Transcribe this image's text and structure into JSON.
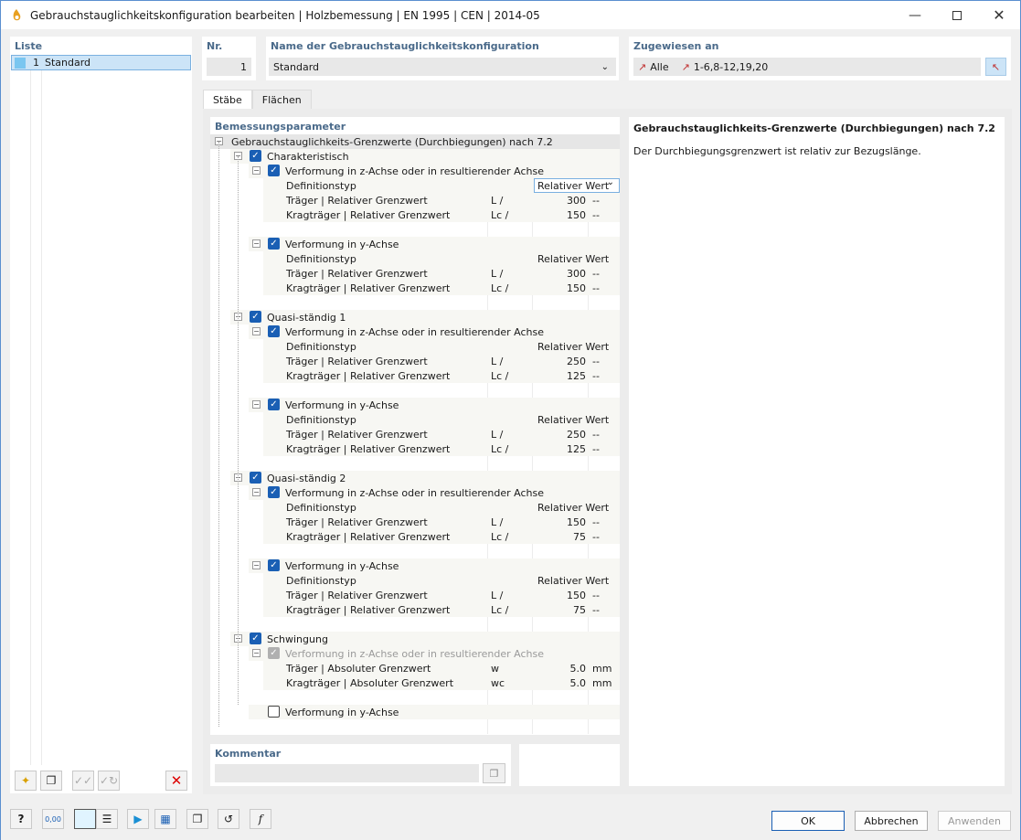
{
  "window": {
    "title": "Gebrauchstauglichkeitskonfiguration bearbeiten | Holzbemessung | EN 1995 | CEN | 2014-05"
  },
  "liste": {
    "title": "Liste",
    "items": [
      {
        "num": "1",
        "label": "Standard"
      }
    ]
  },
  "nr": {
    "title": "Nr.",
    "value": "1"
  },
  "name": {
    "title": "Name der Gebrauchstauglichkeitskonfiguration",
    "value": "Standard"
  },
  "zugewiesen": {
    "title": "Zugewiesen an",
    "alle": "Alle",
    "members": "1-6,8-12,19,20"
  },
  "tabs": [
    "Stäbe",
    "Flächen"
  ],
  "params": {
    "title": "Bemessungsparameter"
  },
  "tree": [
    {
      "lvl": 0,
      "tog": "-",
      "text": "Gebrauchstauglichkeits-Grenzwerte (Durchbiegungen) nach 7.2",
      "hl": true
    },
    {
      "lvl": 1,
      "tog": "-",
      "cb": "on",
      "text": "Charakteristisch"
    },
    {
      "lvl": 2,
      "tog": "-",
      "cb": "on",
      "text": "Verformung in z-Achse oder in resultierender Achse"
    },
    {
      "lvl": 3,
      "text": "Definitionstyp",
      "dropdown": "Relativer Wert"
    },
    {
      "lvl": 3,
      "text": "Träger | Relativer Grenzwert",
      "sym": "L /",
      "val": "300",
      "unit": "--"
    },
    {
      "lvl": 3,
      "text": "Kragträger | Relativer Grenzwert",
      "sym": "Lc /",
      "val": "150",
      "unit": "--"
    },
    {
      "lvl": -1
    },
    {
      "lvl": 2,
      "tog": "-",
      "cb": "on",
      "text": "Verformung in y-Achse"
    },
    {
      "lvl": 3,
      "text": "Definitionstyp",
      "txt": "Relativer Wert"
    },
    {
      "lvl": 3,
      "text": "Träger | Relativer Grenzwert",
      "sym": "L /",
      "val": "300",
      "unit": "--"
    },
    {
      "lvl": 3,
      "text": "Kragträger | Relativer Grenzwert",
      "sym": "Lc /",
      "val": "150",
      "unit": "--"
    },
    {
      "lvl": -1
    },
    {
      "lvl": 1,
      "tog": "-",
      "cb": "on",
      "text": "Quasi-ständig 1"
    },
    {
      "lvl": 2,
      "tog": "-",
      "cb": "on",
      "text": "Verformung in z-Achse oder in resultierender Achse"
    },
    {
      "lvl": 3,
      "text": "Definitionstyp",
      "txt": "Relativer Wert"
    },
    {
      "lvl": 3,
      "text": "Träger | Relativer Grenzwert",
      "sym": "L /",
      "val": "250",
      "unit": "--"
    },
    {
      "lvl": 3,
      "text": "Kragträger | Relativer Grenzwert",
      "sym": "Lc /",
      "val": "125",
      "unit": "--"
    },
    {
      "lvl": -1
    },
    {
      "lvl": 2,
      "tog": "-",
      "cb": "on",
      "text": "Verformung in y-Achse"
    },
    {
      "lvl": 3,
      "text": "Definitionstyp",
      "txt": "Relativer Wert"
    },
    {
      "lvl": 3,
      "text": "Träger | Relativer Grenzwert",
      "sym": "L /",
      "val": "250",
      "unit": "--"
    },
    {
      "lvl": 3,
      "text": "Kragträger | Relativer Grenzwert",
      "sym": "Lc /",
      "val": "125",
      "unit": "--"
    },
    {
      "lvl": -1
    },
    {
      "lvl": 1,
      "tog": "-",
      "cb": "on",
      "text": "Quasi-ständig 2"
    },
    {
      "lvl": 2,
      "tog": "-",
      "cb": "on",
      "text": "Verformung in z-Achse oder in resultierender Achse"
    },
    {
      "lvl": 3,
      "text": "Definitionstyp",
      "txt": "Relativer Wert"
    },
    {
      "lvl": 3,
      "text": "Träger | Relativer Grenzwert",
      "sym": "L /",
      "val": "150",
      "unit": "--"
    },
    {
      "lvl": 3,
      "text": "Kragträger | Relativer Grenzwert",
      "sym": "Lc /",
      "val": "75",
      "unit": "--"
    },
    {
      "lvl": -1
    },
    {
      "lvl": 2,
      "tog": "-",
      "cb": "on",
      "text": "Verformung in y-Achse"
    },
    {
      "lvl": 3,
      "text": "Definitionstyp",
      "txt": "Relativer Wert"
    },
    {
      "lvl": 3,
      "text": "Träger | Relativer Grenzwert",
      "sym": "L /",
      "val": "150",
      "unit": "--"
    },
    {
      "lvl": 3,
      "text": "Kragträger | Relativer Grenzwert",
      "sym": "Lc /",
      "val": "75",
      "unit": "--"
    },
    {
      "lvl": -1
    },
    {
      "lvl": 1,
      "tog": "-",
      "cb": "on",
      "text": "Schwingung"
    },
    {
      "lvl": 2,
      "tog": "-",
      "cb": "dis",
      "text": "Verformung in z-Achse oder in resultierender Achse",
      "dim": true
    },
    {
      "lvl": 3,
      "text": "Träger | Absoluter Grenzwert",
      "sym": "w",
      "val": "5.0",
      "unit": "mm"
    },
    {
      "lvl": 3,
      "text": "Kragträger | Absoluter Grenzwert",
      "sym": "wc",
      "val": "5.0",
      "unit": "mm"
    },
    {
      "lvl": -1
    },
    {
      "lvl": 2,
      "cb": "off",
      "text": "Verformung in y-Achse"
    }
  ],
  "info": {
    "title": "Gebrauchstauglichkeits-Grenzwerte (Durchbiegungen) nach 7.2",
    "text": "Der Durchbiegungsgrenzwert ist relativ zur Bezugslänge."
  },
  "kommentar": {
    "title": "Kommentar",
    "value": ""
  },
  "buttons": {
    "ok": "OK",
    "cancel": "Abbrechen",
    "apply": "Anwenden"
  },
  "bottom_icons": [
    "help-icon",
    "units-icon",
    "color-icon",
    "tree-icon",
    "members-icon",
    "export-icon",
    "copy-icon",
    "reset-icon",
    "formula-icon"
  ],
  "bottom_units_text": "0,00"
}
